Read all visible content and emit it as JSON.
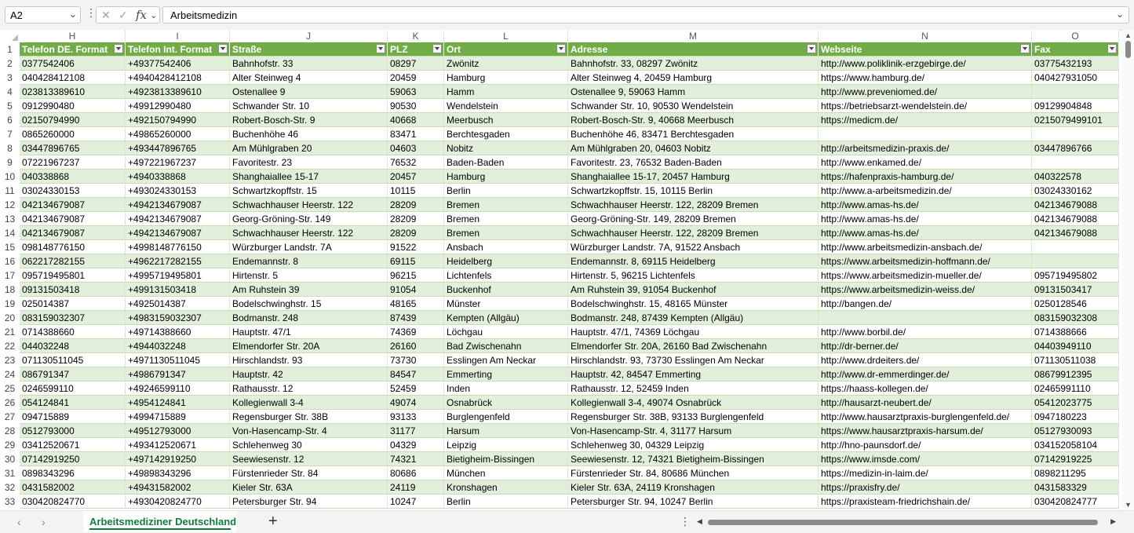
{
  "namebox": {
    "value": "A2"
  },
  "formula": {
    "value": "Arbeitsmedizin"
  },
  "icons": {
    "cancel": "close-icon",
    "confirm": "check-icon",
    "fx": "fx"
  },
  "columns": [
    "H",
    "I",
    "J",
    "K",
    "L",
    "M",
    "N",
    "O"
  ],
  "headers": [
    "Telefon DE. Format",
    "Telefon Int. Format",
    "Straße",
    "PLZ",
    "Ort",
    "Adresse",
    "Webseite",
    "Fax"
  ],
  "rows": [
    [
      "0377542406",
      "+49377542406",
      "Bahnhofstr. 33",
      "08297",
      "Zwönitz",
      "Bahnhofstr. 33, 08297 Zwönitz",
      "http://www.poliklinik-erzgebirge.de/",
      "03775432193"
    ],
    [
      "040428412108",
      "+4940428412108",
      "Alter Steinweg 4",
      "20459",
      "Hamburg",
      "Alter Steinweg 4, 20459 Hamburg",
      "https://www.hamburg.de/",
      "040427931050"
    ],
    [
      "023813389610",
      "+4923813389610",
      "Ostenallee 9",
      "59063",
      "Hamm",
      "Ostenallee 9, 59063 Hamm",
      "http://www.preveniomed.de/",
      ""
    ],
    [
      "0912990480",
      "+49912990480",
      "Schwander Str. 10",
      "90530",
      "Wendelstein",
      "Schwander Str. 10, 90530 Wendelstein",
      "https://betriebsarzt-wendelstein.de/",
      "09129904848"
    ],
    [
      "02150794990",
      "+492150794990",
      "Robert-Bosch-Str. 9",
      "40668",
      "Meerbusch",
      "Robert-Bosch-Str. 9, 40668 Meerbusch",
      "https://medicm.de/",
      "0215079499101"
    ],
    [
      "0865260000",
      "+49865260000",
      "Buchenhöhe 46",
      "83471",
      "Berchtesgaden",
      "Buchenhöhe 46, 83471 Berchtesgaden",
      "",
      ""
    ],
    [
      "03447896765",
      "+493447896765",
      "Am Mühlgraben 20",
      "04603",
      "Nobitz",
      "Am Mühlgraben 20, 04603 Nobitz",
      "http://arbeitsmedizin-praxis.de/",
      "03447896766"
    ],
    [
      "07221967237",
      "+497221967237",
      "Favoritestr. 23",
      "76532",
      "Baden-Baden",
      "Favoritestr. 23, 76532 Baden-Baden",
      "http://www.enkamed.de/",
      ""
    ],
    [
      "040338868",
      "+4940338868",
      "Shanghaiallee 15-17",
      "20457",
      "Hamburg",
      "Shanghaiallee 15-17, 20457 Hamburg",
      "https://hafenpraxis-hamburg.de/",
      "040322578"
    ],
    [
      "03024330153",
      "+493024330153",
      "Schwartzkopffstr. 15",
      "10115",
      "Berlin",
      "Schwartzkopffstr. 15, 10115 Berlin",
      "http://www.a-arbeitsmedizin.de/",
      "03024330162"
    ],
    [
      "042134679087",
      "+4942134679087",
      "Schwachhauser Heerstr. 122",
      "28209",
      "Bremen",
      "Schwachhauser Heerstr. 122, 28209 Bremen",
      "http://www.amas-hs.de/",
      "042134679088"
    ],
    [
      "042134679087",
      "+4942134679087",
      "Georg-Gröning-Str. 149",
      "28209",
      "Bremen",
      "Georg-Gröning-Str. 149, 28209 Bremen",
      "http://www.amas-hs.de/",
      "042134679088"
    ],
    [
      "042134679087",
      "+4942134679087",
      "Schwachhauser Heerstr. 122",
      "28209",
      "Bremen",
      "Schwachhauser Heerstr. 122, 28209 Bremen",
      "http://www.amas-hs.de/",
      "042134679088"
    ],
    [
      "098148776150",
      "+4998148776150",
      "Würzburger Landstr. 7A",
      "91522",
      "Ansbach",
      "Würzburger Landstr. 7A, 91522 Ansbach",
      "http://www.arbeitsmedizin-ansbach.de/",
      ""
    ],
    [
      "062217282155",
      "+4962217282155",
      "Endemannstr. 8",
      "69115",
      "Heidelberg",
      "Endemannstr. 8, 69115 Heidelberg",
      "https://www.arbeitsmedizin-hoffmann.de/",
      ""
    ],
    [
      "095719495801",
      "+4995719495801",
      "Hirtenstr. 5",
      "96215",
      "Lichtenfels",
      "Hirtenstr. 5, 96215 Lichtenfels",
      "https://www.arbeitsmedizin-mueller.de/",
      "095719495802"
    ],
    [
      "09131503418",
      "+499131503418",
      "Am Ruhstein 39",
      "91054",
      "Buckenhof",
      "Am Ruhstein 39, 91054 Buckenhof",
      "https://www.arbeitsmedizin-weiss.de/",
      "09131503417"
    ],
    [
      "025014387",
      "+4925014387",
      "Bodelschwinghstr. 15",
      "48165",
      "Münster",
      "Bodelschwinghstr. 15, 48165 Münster",
      "http://bangen.de/",
      "0250128546"
    ],
    [
      "083159032307",
      "+4983159032307",
      "Bodmanstr. 248",
      "87439",
      "Kempten (Allgäu)",
      "Bodmanstr. 248, 87439 Kempten (Allgäu)",
      "",
      "083159032308"
    ],
    [
      "0714388660",
      "+49714388660",
      "Hauptstr. 47/1",
      "74369",
      "Löchgau",
      "Hauptstr. 47/1, 74369 Löchgau",
      "http://www.borbil.de/",
      "0714388666"
    ],
    [
      "044032248",
      "+4944032248",
      "Elmendorfer Str. 20A",
      "26160",
      "Bad Zwischenahn",
      "Elmendorfer Str. 20A, 26160 Bad Zwischenahn",
      "http://dr-berner.de/",
      "04403949110"
    ],
    [
      "071130511045",
      "+4971130511045",
      "Hirschlandstr. 93",
      "73730",
      "Esslingen Am Neckar",
      "Hirschlandstr. 93, 73730 Esslingen Am Neckar",
      "http://www.drdeiters.de/",
      "071130511038"
    ],
    [
      "086791347",
      "+4986791347",
      "Hauptstr. 42",
      "84547",
      "Emmerting",
      "Hauptstr. 42, 84547 Emmerting",
      "http://www.dr-emmerdinger.de/",
      "08679912395"
    ],
    [
      "0246599110",
      "+49246599110",
      "Rathausstr. 12",
      "52459",
      "Inden",
      "Rathausstr. 12, 52459 Inden",
      "https://haass-kollegen.de/",
      "02465991110"
    ],
    [
      "054124841",
      "+4954124841",
      "Kollegienwall 3-4",
      "49074",
      "Osnabrück",
      "Kollegienwall 3-4, 49074 Osnabrück",
      "http://hausarzt-neubert.de/",
      "05412023775"
    ],
    [
      "094715889",
      "+4994715889",
      "Regensburger Str. 38B",
      "93133",
      "Burglengenfeld",
      "Regensburger Str. 38B, 93133 Burglengenfeld",
      "http://www.hausarztpraxis-burglengenfeld.de/",
      "0947180223"
    ],
    [
      "0512793000",
      "+49512793000",
      "Von-Hasencamp-Str. 4",
      "31177",
      "Harsum",
      "Von-Hasencamp-Str. 4, 31177 Harsum",
      "https://www.hausarztpraxis-harsum.de/",
      "05127930093"
    ],
    [
      "03412520671",
      "+493412520671",
      "Schlehenweg 30",
      "04329",
      "Leipzig",
      "Schlehenweg 30, 04329 Leipzig",
      "http://hno-paunsdorf.de/",
      "034152058104"
    ],
    [
      "07142919250",
      "+497142919250",
      "Seewiesenstr. 12",
      "74321",
      "Bietigheim-Bissingen",
      "Seewiesenstr. 12, 74321 Bietigheim-Bissingen",
      "https://www.imsde.com/",
      "07142919225"
    ],
    [
      "0898343296",
      "+49898343296",
      "Fürstenrieder Str. 84",
      "80686",
      "München",
      "Fürstenrieder Str. 84, 80686 München",
      "https://medizin-in-laim.de/",
      "0898211295"
    ],
    [
      "0431582002",
      "+49431582002",
      "Kieler Str. 63A",
      "24119",
      "Kronshagen",
      "Kieler Str. 63A, 24119 Kronshagen",
      "https://praxisfry.de/",
      "0431583329"
    ],
    [
      "030420824770",
      "+4930420824770",
      "Petersburger Str. 94",
      "10247",
      "Berlin",
      "Petersburger Str. 94, 10247 Berlin",
      "https://praxisteam-friedrichshain.de/",
      "030420824777"
    ]
  ],
  "sheets": [
    {
      "label": "Arbeitsmediziner Deutschland",
      "active": true
    }
  ],
  "colors": {
    "header": "#70ad47",
    "band": "#e2efda",
    "accent": "#107c41"
  }
}
